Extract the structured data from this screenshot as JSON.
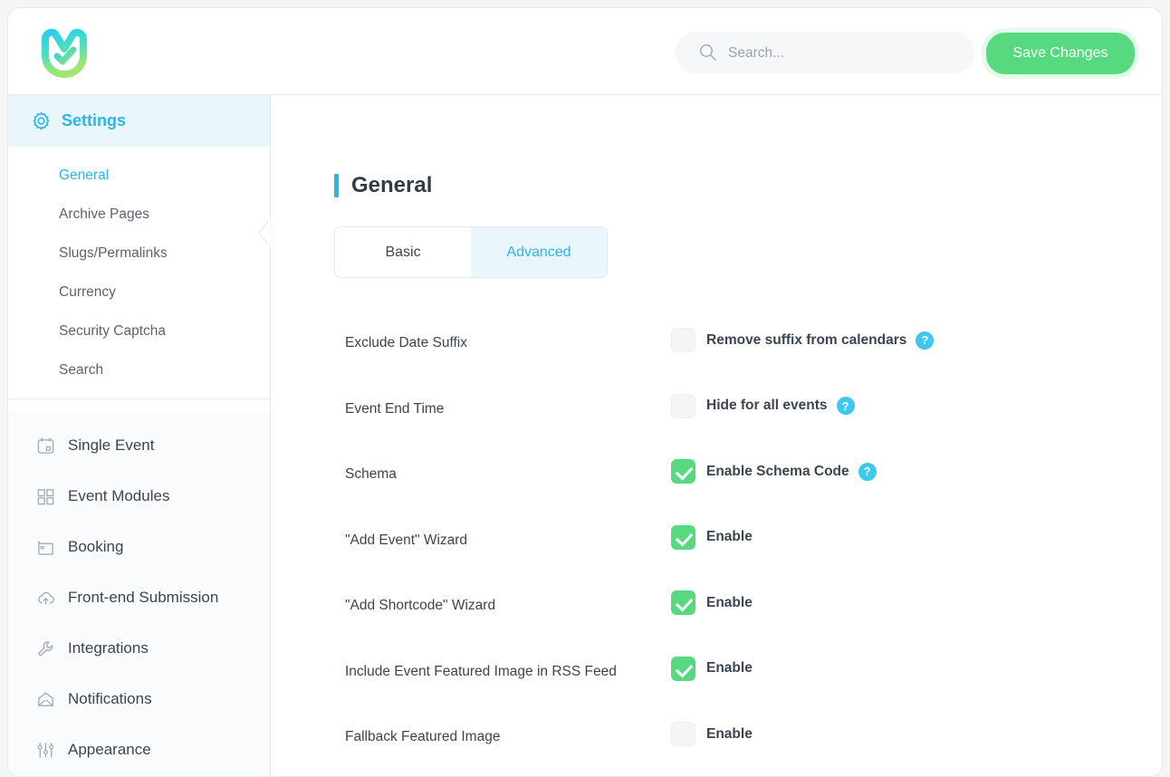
{
  "header": {
    "logo_name": "mec-logo",
    "search": {
      "placeholder": "Search...",
      "value": "",
      "icon": "search-icon"
    },
    "save_label": "Save Changes"
  },
  "colors": {
    "accent_cyan": "#29b6e8",
    "accent_cyan_bg": "#e9f7fc",
    "green": "#56d97f",
    "help_blue": "#3ec8ef",
    "text_dark": "#3c4552"
  },
  "sidebar": {
    "settings": {
      "label": "Settings",
      "icon": "gear-icon",
      "active": true
    },
    "submenu": [
      {
        "label": "General",
        "active": true
      },
      {
        "label": "Archive Pages",
        "active": false
      },
      {
        "label": "Slugs/Permalinks",
        "active": false
      },
      {
        "label": "Currency",
        "active": false
      },
      {
        "label": "Security Captcha",
        "active": false
      },
      {
        "label": "Search",
        "active": false
      }
    ],
    "menu": [
      {
        "label": "Single Event",
        "icon": "calendar-icon"
      },
      {
        "label": "Event Modules",
        "icon": "grid-icon"
      },
      {
        "label": "Booking",
        "icon": "wallet-icon"
      },
      {
        "label": "Front-end Submission",
        "icon": "cloud-upload-icon"
      },
      {
        "label": "Integrations",
        "icon": "wrench-icon"
      },
      {
        "label": "Notifications",
        "icon": "envelope-icon"
      },
      {
        "label": "Appearance",
        "icon": "sliders-icon"
      }
    ]
  },
  "main": {
    "page_title": "General",
    "tabs": [
      {
        "label": "Basic",
        "active": false
      },
      {
        "label": "Advanced",
        "active": true
      }
    ],
    "rows": [
      {
        "label": "Exclude Date Suffix",
        "control_label": "Remove suffix from calendars",
        "checked": false,
        "help": "?"
      },
      {
        "label": "Event End Time",
        "control_label": "Hide for all events",
        "checked": false,
        "help": "?"
      },
      {
        "label": "Schema",
        "control_label": "Enable Schema Code",
        "checked": true,
        "help": "?"
      },
      {
        "label": "\"Add Event\" Wizard",
        "control_label": "Enable",
        "checked": true,
        "help": null
      },
      {
        "label": "\"Add Shortcode\" Wizard",
        "control_label": "Enable",
        "checked": true,
        "help": null
      },
      {
        "label": "Include Event Featured Image in RSS Feed",
        "control_label": "Enable",
        "checked": true,
        "help": null
      },
      {
        "label": "Fallback Featured Image",
        "control_label": "Enable",
        "checked": false,
        "help": null
      }
    ]
  }
}
